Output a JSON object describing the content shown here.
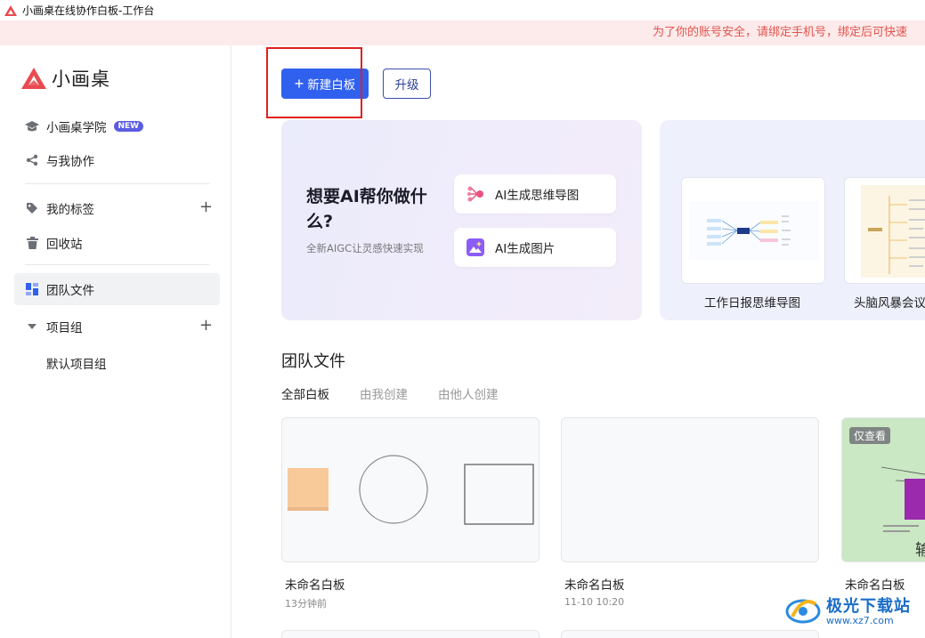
{
  "window": {
    "title": "小画桌在线协作白板-工作台"
  },
  "notice": {
    "text": "为了你的账号安全，请绑定手机号，绑定后可快速"
  },
  "brand": {
    "name": "小画桌",
    "color": "#e94a4f"
  },
  "sidebar": {
    "academy": {
      "label": "小画桌学院",
      "badge": "NEW"
    },
    "collab": {
      "label": "与我协作"
    },
    "tags": {
      "label": "我的标签"
    },
    "trash": {
      "label": "回收站"
    },
    "team_files": {
      "label": "团队文件"
    },
    "project_group": {
      "label": "项目组",
      "sub_items": [
        "默认项目组"
      ]
    }
  },
  "toolbar": {
    "new_board_label": "新建白板",
    "upgrade_label": "升级",
    "accent": "#3060ee"
  },
  "ai_banner": {
    "title": "想要AI帮你做什么?",
    "subtitle": "全新AIGC让灵感快速实现",
    "actions": [
      "AI生成思维导图",
      "AI生成图片"
    ]
  },
  "templates": [
    {
      "label": "工作日报思维导图"
    },
    {
      "label": "头脑风暴会议"
    }
  ],
  "files_section": {
    "title": "团队文件",
    "tabs": [
      "全部白板",
      "由我创建",
      "由他人创建"
    ],
    "active_tab": 0
  },
  "files": [
    {
      "name": "未命名白板",
      "time": "13分钟前"
    },
    {
      "name": "未命名白板",
      "time": "11-10 10:20"
    },
    {
      "name": "未命名白板",
      "badge": "仅查看",
      "preview_text": "输"
    }
  ],
  "watermark": {
    "main": "极光下载站",
    "sub": "www.xz7.com"
  }
}
